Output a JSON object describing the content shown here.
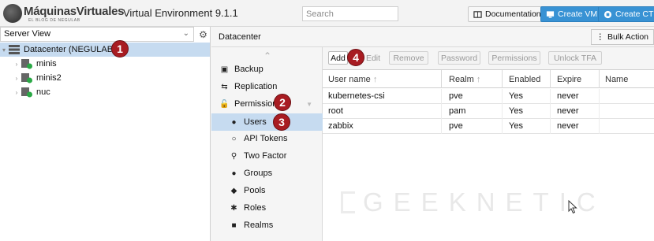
{
  "header": {
    "logo_text": "MáquinasVirtuales",
    "logo_tagline": "EL BLOG DE NEGULAB",
    "app_title": "Virtual Environment 9.1.1",
    "search_placeholder": "Search",
    "documentation_label": "Documentation",
    "create_vm_label": "Create VM",
    "create_ct_label": "Create CT"
  },
  "resource_tree": {
    "view_selector": "Server View",
    "nodes": [
      {
        "label": "Datacenter (NEGULAB)",
        "type": "datacenter",
        "selected": true
      },
      {
        "label": "minis",
        "type": "node"
      },
      {
        "label": "minis2",
        "type": "node"
      },
      {
        "label": "nuc",
        "type": "node"
      }
    ]
  },
  "content_header": {
    "title": "Datacenter",
    "bulk_action_label": "Bulk Action"
  },
  "nav": {
    "items": [
      {
        "label": "Backup",
        "icon": "floppy-icon"
      },
      {
        "label": "Replication",
        "icon": "replication-icon"
      },
      {
        "label": "Permissions",
        "icon": "unlock-icon",
        "expandable": true
      },
      {
        "label": "Users",
        "icon": "user-icon",
        "selected": true,
        "indent": true
      },
      {
        "label": "API Tokens",
        "icon": "user-outline-icon",
        "indent": true
      },
      {
        "label": "Two Factor",
        "icon": "key-icon",
        "indent": true
      },
      {
        "label": "Groups",
        "icon": "users-icon",
        "indent": true
      },
      {
        "label": "Pools",
        "icon": "tags-icon",
        "indent": true
      },
      {
        "label": "Roles",
        "icon": "male-icon",
        "indent": true
      },
      {
        "label": "Realms",
        "icon": "realm-icon",
        "indent": true
      }
    ]
  },
  "grid_toolbar": {
    "add": "Add",
    "edit": "Edit",
    "remove": "Remove",
    "password": "Password",
    "permissions": "Permissions",
    "unlock_tfa": "Unlock TFA"
  },
  "users_table": {
    "columns": [
      "User name",
      "Realm",
      "Enabled",
      "Expire",
      "Name"
    ],
    "sort_indicators": [
      "↑",
      "↑"
    ],
    "rows": [
      [
        "kubernetes-csi",
        "pve",
        "Yes",
        "never",
        ""
      ],
      [
        "root",
        "pam",
        "Yes",
        "never",
        ""
      ],
      [
        "zabbix",
        "pve",
        "Yes",
        "never",
        ""
      ]
    ]
  },
  "annotations": [
    "1",
    "2",
    "3",
    "4"
  ],
  "watermark": "GEEKNETIC",
  "colors": {
    "accent_blue": "#3892d4",
    "selection": "#c6dbf0",
    "annotation_badge": "#a81c22"
  }
}
